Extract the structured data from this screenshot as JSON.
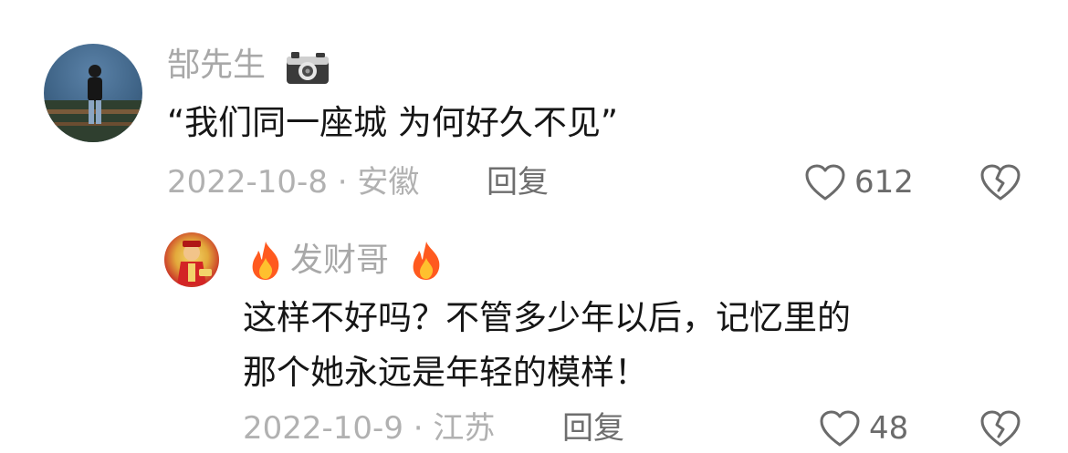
{
  "comments": [
    {
      "username": "郜先生",
      "badge_icon": "camera-icon",
      "text": "“我们同一座城 为何好久不见”",
      "date_location": "2022-10-8 · 安徽",
      "reply_label": "回复",
      "like_count": "612"
    }
  ],
  "replies": [
    {
      "prefix_icon": "fire-icon",
      "username": "发财哥",
      "suffix_icon": "fire-icon",
      "text_line1": "这样不好吗？不管多少年以后，记忆里的",
      "text_line2": "那个她永远是年轻的模样！",
      "date_location": "2022-10-9 · 江苏",
      "reply_label": "回复",
      "like_count": "48"
    }
  ],
  "colors": {
    "text": "#161616",
    "muted": "#a8a8a8",
    "fire": "#ff5a1f"
  }
}
